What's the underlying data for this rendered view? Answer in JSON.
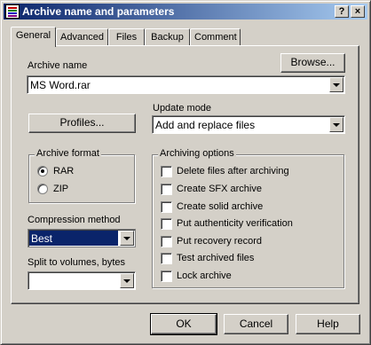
{
  "window": {
    "title": "Archive name and parameters",
    "help_label": "?",
    "close_label": "×"
  },
  "tabs": [
    {
      "label": "General",
      "active": true
    },
    {
      "label": "Advanced",
      "active": false
    },
    {
      "label": "Files",
      "active": false
    },
    {
      "label": "Backup",
      "active": false
    },
    {
      "label": "Comment",
      "active": false
    }
  ],
  "general": {
    "archive_name_label": "Archive name",
    "browse_label": "Browse...",
    "archive_name_value": "MS Word.rar",
    "profiles_label": "Profiles...",
    "update_mode_label": "Update mode",
    "update_mode_value": "Add and replace files",
    "archive_format_label": "Archive format",
    "formats": [
      {
        "label": "RAR",
        "selected": true
      },
      {
        "label": "ZIP",
        "selected": false
      }
    ],
    "compression_label": "Compression method",
    "compression_value": "Best",
    "split_label": "Split to volumes, bytes",
    "split_value": "",
    "archiving_options_label": "Archiving options",
    "options": [
      {
        "label": "Delete files after archiving",
        "checked": false
      },
      {
        "label": "Create SFX archive",
        "checked": false
      },
      {
        "label": "Create solid archive",
        "checked": false
      },
      {
        "label": "Put authenticity verification",
        "checked": false
      },
      {
        "label": "Put recovery record",
        "checked": false
      },
      {
        "label": "Test archived files",
        "checked": false
      },
      {
        "label": "Lock archive",
        "checked": false
      }
    ]
  },
  "footer": {
    "ok_label": "OK",
    "cancel_label": "Cancel",
    "help_label": "Help"
  }
}
